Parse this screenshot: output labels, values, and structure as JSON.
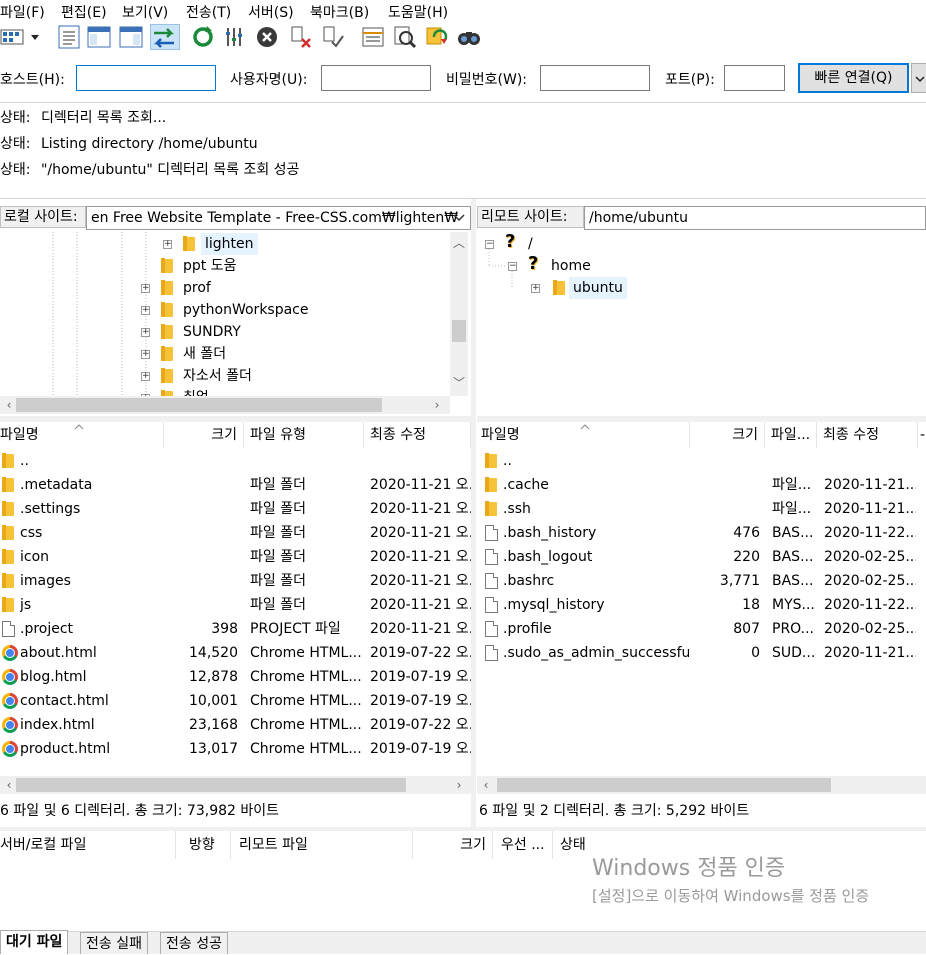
{
  "menu": [
    "파일(F)",
    "편집(E)",
    "보기(V)",
    "전송(T)",
    "서버(S)",
    "북마크(B)",
    "도움말(H)"
  ],
  "quickconnect": {
    "host_label": "호스트(H):",
    "host_value": "",
    "user_label": "사용자명(U):",
    "user_value": "",
    "pass_label": "비밀번호(W):",
    "pass_value": "",
    "port_label": "포트(P):",
    "port_value": "",
    "connect_button": "빠른 연결(Q)"
  },
  "log": [
    {
      "label": "상태:",
      "text": "디렉터리 목록 조회..."
    },
    {
      "label": "상태:",
      "text": "Listing directory /home/ubuntu"
    },
    {
      "label": "상태:",
      "text": "\"/home/ubuntu\" 디렉터리 목록 조회 성공"
    }
  ],
  "local": {
    "site_label": "로컬 사이트:",
    "path": "en Free Website Template - Free-CSS.com₩lighten₩",
    "tree": [
      {
        "name": "lighten",
        "expand": true,
        "highlight": true
      },
      {
        "name": "ppt 도움",
        "expand": false
      },
      {
        "name": "prof",
        "expand": true
      },
      {
        "name": "pythonWorkspace",
        "expand": true
      },
      {
        "name": "SUNDRY",
        "expand": true
      },
      {
        "name": "새 폴더",
        "expand": true
      },
      {
        "name": "자소서 폴더",
        "expand": true
      },
      {
        "name": "취업",
        "expand": true
      }
    ],
    "columns": [
      "파일명",
      "크기",
      "파일 유형",
      "최종 수정"
    ],
    "files": [
      {
        "name": "..",
        "size": "",
        "type": "",
        "modified": "",
        "icon": "folder"
      },
      {
        "name": ".metadata",
        "size": "",
        "type": "파일 폴더",
        "modified": "2020-11-21 오...",
        "icon": "folder"
      },
      {
        "name": ".settings",
        "size": "",
        "type": "파일 폴더",
        "modified": "2020-11-21 오...",
        "icon": "folder"
      },
      {
        "name": "css",
        "size": "",
        "type": "파일 폴더",
        "modified": "2020-11-21 오...",
        "icon": "folder"
      },
      {
        "name": "icon",
        "size": "",
        "type": "파일 폴더",
        "modified": "2020-11-21 오...",
        "icon": "folder"
      },
      {
        "name": "images",
        "size": "",
        "type": "파일 폴더",
        "modified": "2020-11-21 오...",
        "icon": "folder"
      },
      {
        "name": "js",
        "size": "",
        "type": "파일 폴더",
        "modified": "2020-11-21 오...",
        "icon": "folder"
      },
      {
        "name": ".project",
        "size": "398",
        "type": "PROJECT 파일",
        "modified": "2020-11-21 오...",
        "icon": "file"
      },
      {
        "name": "about.html",
        "size": "14,520",
        "type": "Chrome HTML...",
        "modified": "2019-07-22 오...",
        "icon": "chrome"
      },
      {
        "name": "blog.html",
        "size": "12,878",
        "type": "Chrome HTML...",
        "modified": "2019-07-19 오...",
        "icon": "chrome"
      },
      {
        "name": "contact.html",
        "size": "10,001",
        "type": "Chrome HTML...",
        "modified": "2019-07-19 오...",
        "icon": "chrome"
      },
      {
        "name": "index.html",
        "size": "23,168",
        "type": "Chrome HTML...",
        "modified": "2019-07-22 오...",
        "icon": "chrome"
      },
      {
        "name": "product.html",
        "size": "13,017",
        "type": "Chrome HTML...",
        "modified": "2019-07-19 오...",
        "icon": "chrome"
      }
    ],
    "status": "6 파일 및 6 디렉터리. 총 크기: 73,982 바이트"
  },
  "remote": {
    "site_label": "리모트 사이트:",
    "path": "/home/ubuntu",
    "tree": [
      {
        "name": "/",
        "icon": "question"
      },
      {
        "name": "home",
        "icon": "question"
      },
      {
        "name": "ubuntu",
        "icon": "folder",
        "highlight": true
      }
    ],
    "columns": [
      "파일명",
      "크기",
      "파일...",
      "최종 수정",
      "-"
    ],
    "files": [
      {
        "name": "..",
        "size": "",
        "type": "",
        "modified": "",
        "icon": "folder"
      },
      {
        "name": ".cache",
        "size": "",
        "type": "파일...",
        "modified": "2020-11-21...",
        "icon": "folder"
      },
      {
        "name": ".ssh",
        "size": "",
        "type": "파일...",
        "modified": "2020-11-21...",
        "icon": "folder"
      },
      {
        "name": ".bash_history",
        "size": "476",
        "type": "BAS...",
        "modified": "2020-11-22...",
        "icon": "file"
      },
      {
        "name": ".bash_logout",
        "size": "220",
        "type": "BAS...",
        "modified": "2020-02-25...",
        "icon": "file"
      },
      {
        "name": ".bashrc",
        "size": "3,771",
        "type": "BAS...",
        "modified": "2020-02-25...",
        "icon": "file"
      },
      {
        "name": ".mysql_history",
        "size": "18",
        "type": "MYS...",
        "modified": "2020-11-22...",
        "icon": "file"
      },
      {
        "name": ".profile",
        "size": "807",
        "type": "PRO...",
        "modified": "2020-02-25...",
        "icon": "file"
      },
      {
        "name": ".sudo_as_admin_successful",
        "size": "0",
        "type": "SUD...",
        "modified": "2020-11-21...",
        "icon": "file"
      }
    ],
    "status": "6 파일 및 2 디렉터리. 총 크기: 5,292 바이트"
  },
  "queue": {
    "columns": [
      "서버/로컬 파일",
      "방향",
      "리모트 파일",
      "크기",
      "우선 ...",
      "상태"
    ],
    "tabs": [
      "대기 파일",
      "전송 실패",
      "전송 성공"
    ]
  },
  "watermark": {
    "title": "Windows 정품 인증",
    "subtitle": "[설정]으로 이동하여 Windows를 정품 인증"
  }
}
